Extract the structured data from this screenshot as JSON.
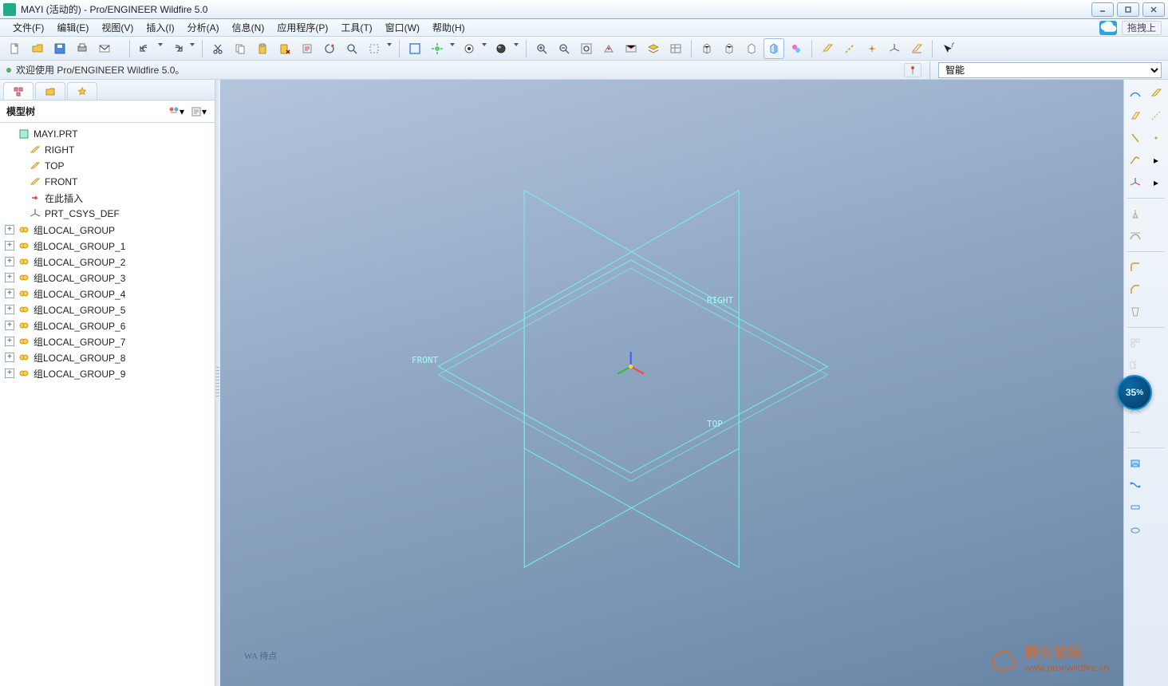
{
  "window": {
    "title": "MAYI (活动的) - Pro/ENGINEER Wildfire 5.0"
  },
  "menu": {
    "items": [
      "文件(F)",
      "编辑(E)",
      "视图(V)",
      "插入(I)",
      "分析(A)",
      "信息(N)",
      "应用程序(P)",
      "工具(T)",
      "窗口(W)",
      "帮助(H)"
    ],
    "drag_hint": "拖拽上"
  },
  "message_bar": {
    "text": "欢迎使用 Pro/ENGINEER Wildfire 5.0。",
    "filter_label": "智能"
  },
  "model_tree": {
    "title": "模型树",
    "root": "MAYI.PRT",
    "datums": [
      "RIGHT",
      "TOP",
      "FRONT"
    ],
    "insert_here": "在此插入",
    "csys": "PRT_CSYS_DEF",
    "groups": [
      "组LOCAL_GROUP",
      "组LOCAL_GROUP_1",
      "组LOCAL_GROUP_2",
      "组LOCAL_GROUP_3",
      "组LOCAL_GROUP_4",
      "组LOCAL_GROUP_5",
      "组LOCAL_GROUP_6",
      "组LOCAL_GROUP_7",
      "组LOCAL_GROUP_8",
      "组LOCAL_GROUP_9"
    ]
  },
  "viewport": {
    "label_right": "RIGHT",
    "label_top": "TOP",
    "label_front": "FRONT",
    "hint": "WA 待点"
  },
  "badge": {
    "value": "35",
    "suffix": "%"
  },
  "watermark": {
    "line1": "野火论坛",
    "line2": "www.proewildfire.cn"
  }
}
